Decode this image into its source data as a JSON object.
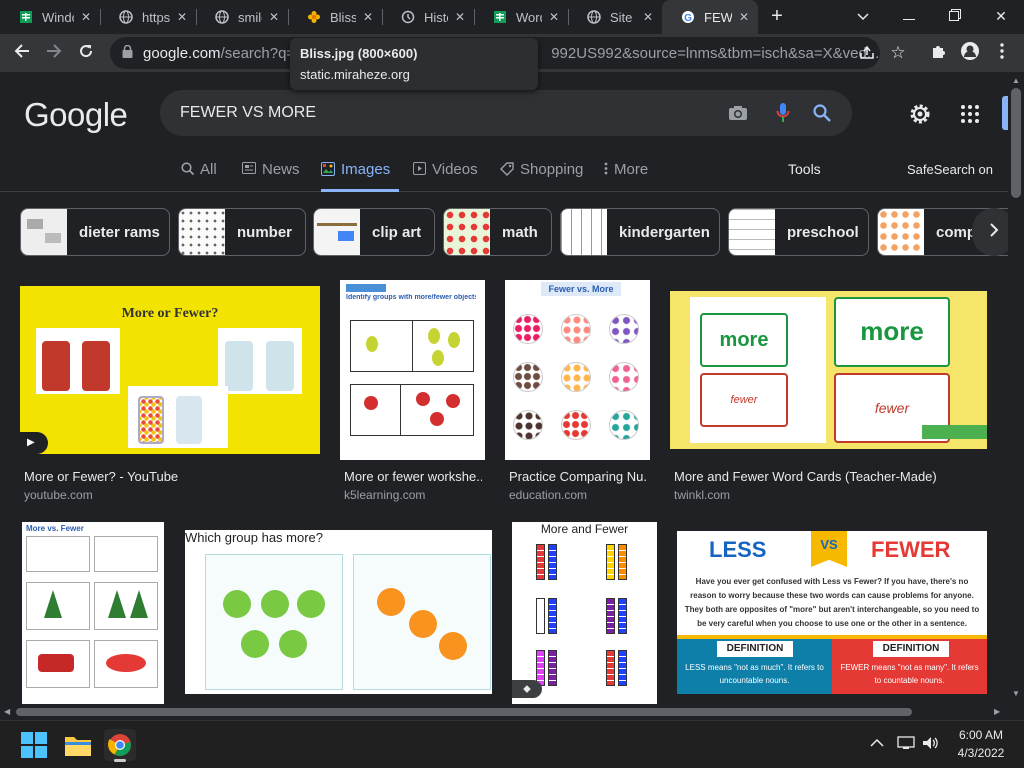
{
  "tabs": [
    {
      "label": "Windo",
      "icon": "sheets-icon"
    },
    {
      "label": "https:",
      "icon": "globe-icon"
    },
    {
      "label": "smile",
      "icon": "globe-icon"
    },
    {
      "label": "Bliss.jp",
      "icon": "flower-icon"
    },
    {
      "label": "Histo",
      "icon": "history-icon"
    },
    {
      "label": "Word",
      "icon": "sheets-icon"
    },
    {
      "label": "Site E",
      "icon": "globe-icon"
    },
    {
      "label": "FEWE",
      "icon": "google-icon"
    }
  ],
  "tooltip": {
    "title": "Bliss.jpg (800×600)",
    "host": "static.miraheze.org"
  },
  "omnibox": {
    "host": "google.com",
    "rest": "/search?q=",
    "rest2": "992US992&source=lnms&tbm=isch&sa=X&ved..."
  },
  "search": {
    "query": "FEWER VS MORE",
    "logo": "Google"
  },
  "navtabs": [
    {
      "label": "All",
      "icon": "search-icon"
    },
    {
      "label": "News",
      "icon": "news-icon"
    },
    {
      "label": "Images",
      "icon": "image-icon"
    },
    {
      "label": "Videos",
      "icon": "video-icon"
    },
    {
      "label": "Shopping",
      "icon": "tag-icon"
    },
    {
      "label": "More",
      "icon": "more-vert-icon"
    }
  ],
  "tools": {
    "tools_label": "Tools",
    "safesearch_label": "SafeSearch on"
  },
  "chips": [
    {
      "label": "dieter rams"
    },
    {
      "label": "number"
    },
    {
      "label": "clip art"
    },
    {
      "label": "math"
    },
    {
      "label": "kindergarten"
    },
    {
      "label": "preschool"
    },
    {
      "label": "comp"
    }
  ],
  "results": [
    {
      "title": "More or Fewer? - YouTube",
      "source": "youtube.com",
      "img_text": "More or Fewer?"
    },
    {
      "title": "More or fewer workshe...",
      "source": "k5learning.com",
      "img_text": "Identify groups with more/fewer objects"
    },
    {
      "title": "Practice Comparing Nu...",
      "source": "education.com",
      "img_text": "Fewer vs. More"
    },
    {
      "title": "More and Fewer Word Cards (Teacher-Made)",
      "source": "twinkl.com",
      "img_text": "more",
      "img_text2": "fewer"
    }
  ],
  "results_row2": [
    {
      "img_text": "More vs. Fewer"
    },
    {
      "img_text": "Which group has more?"
    },
    {
      "img_text": "More and Fewer"
    },
    {
      "img_text": "LESS",
      "img_text2": "VS",
      "img_text3": "FEWER",
      "def1": "DEFINITION",
      "def2": "DEFINITION",
      "less_def": "LESS means \"not as much\". It refers to uncountable nouns.",
      "fewer_def": "FEWER means \"not as many\". It refers to countable nouns.",
      "body": "Have you ever get confused with Less vs Fewer? If you have, there's no reason to worry because these two words can cause problems for anyone. They both are opposites of \"more\" but aren't interchangeable, so you need to be very careful when you choose to use one or the other in a sentence."
    }
  ],
  "clock": {
    "time": "6:00 AM",
    "date": "4/3/2022"
  },
  "colors": {
    "accent": "#8ab4f8",
    "background": "#202124"
  }
}
